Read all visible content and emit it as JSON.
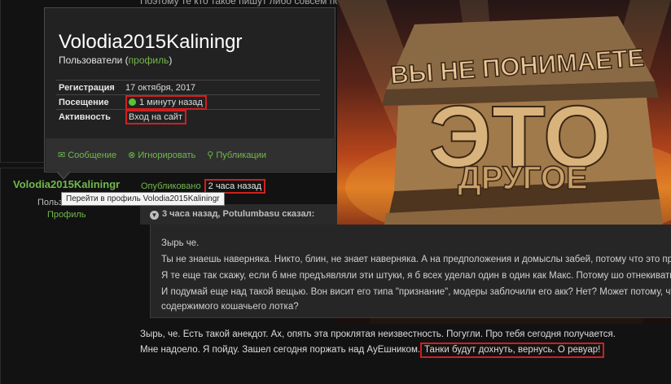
{
  "background": {
    "top_text": "Поэтому те кто такое пишут либо совсем псих"
  },
  "post": {
    "username": "Volodia2015Kaliningr",
    "usergroup": "Пользователи",
    "profile_link": "Профиль",
    "published_label": "Опубликовано",
    "published_time": "2 часа назад",
    "tooltip": "Перейти в профиль Volodia2015Kaliningr",
    "quote": {
      "header": "3 часа назад, Potulumbasu сказал:",
      "lines": [
        "Зырь че.",
        "Ты не знаешь наверняка. Никто, блин, не знает наверняка. А на предположения и домыслы забей, потому что это предпо",
        "Я те еще так скажу, если б мне предъявляли эти штуки, я б всех уделал один в один как Макс. Потому шо отнекиваться это сказ",
        "И подумай еще над такой вещью. Вон висит его типа \"признание\", модеры заблочили его акк? Нет? Может потому, что з",
        "содержимого кошачьего лотка?"
      ]
    },
    "text_line1": "Зырь, че. Есть такой анекдот. Ах, опять эта проклятая неизвестность. Погугли. Про тебя сегодня получается.",
    "text_line2": "Мне надоело. Я пойду. Зашел сегодня поржать над АуЕшником.",
    "text_highlight": "Танки будут дохнуть, вернусь. О ревуар!"
  },
  "poster": {
    "line_top": "ВЫ НЕ ПОНИМАЕТЕ",
    "line_mid": "ЭТО",
    "line_bottom": "ДРУГОЕ"
  },
  "card": {
    "name": "Volodia2015Kaliningr",
    "group": "Пользователи",
    "group_link": "профиль",
    "registration_label": "Регистрация",
    "registration_value": "17 октября, 2017",
    "visit_label": "Посещение",
    "visit_value": "1 минуту назад",
    "activity_label": "Активность",
    "activity_value": "Вход на сайт",
    "actions": {
      "message": "Сообщение",
      "ignore": "Игнорировать",
      "publications": "Публикации"
    }
  },
  "colors": {
    "accent_green": "#72b84c",
    "highlight_red": "#d01f1f",
    "online_dot": "#5ac23a"
  }
}
